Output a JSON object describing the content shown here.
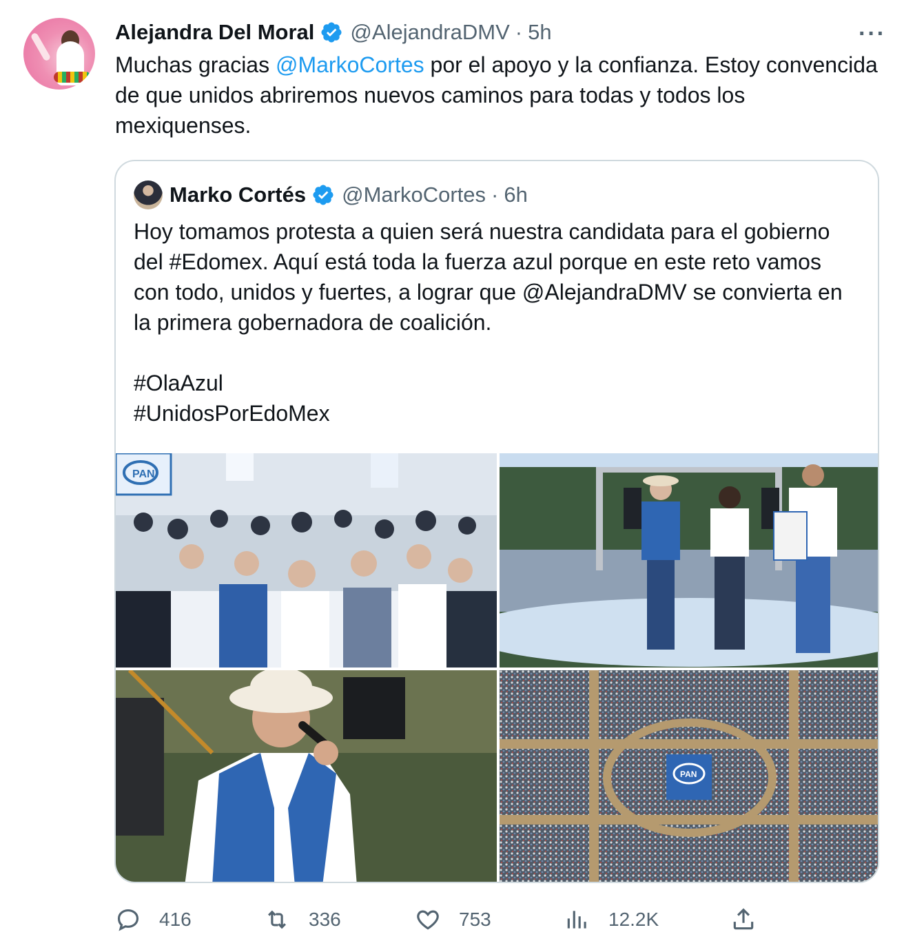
{
  "tweet": {
    "author_name": "Alejandra Del Moral",
    "author_handle": "@AlejandraDMV",
    "separator": "·",
    "time": "5h",
    "more_label": "···",
    "text_parts": {
      "before": "Muchas gracias ",
      "mention": "@MarkoCortes",
      "after": " por el apoyo y la confianza. Estoy convencida de que unidos abriremos nuevos caminos para todas y todos los mexiquenses."
    }
  },
  "quote": {
    "author_name": "Marko Cortés",
    "author_handle": "@MarkoCortes",
    "separator": "·",
    "time": "6h",
    "paragraph1": "Hoy tomamos protesta a quien será nuestra candidata para el gobierno del #Edomex. Aquí está toda la fuerza azul porque en este reto vamos con todo, unidos y fuertes, a lograr que @AlejandraDMV se convierta en la primera gobernadora de coalición.",
    "hashtag1": "#OlaAzul",
    "hashtag2": "#UnidosPorEdoMex",
    "photo_text": {
      "flag": "PAN",
      "sign": "PAN"
    }
  },
  "actions": {
    "replies": "416",
    "retweets": "336",
    "likes": "753",
    "views": "12.2K"
  },
  "colors": {
    "accent": "#1d9bf0",
    "text": "#0f1419",
    "secondary": "#536471",
    "border": "#cfd9de"
  },
  "icons": [
    "verified-badge-icon",
    "more-icon",
    "reply-icon",
    "retweet-icon",
    "like-icon",
    "views-icon",
    "share-icon"
  ]
}
